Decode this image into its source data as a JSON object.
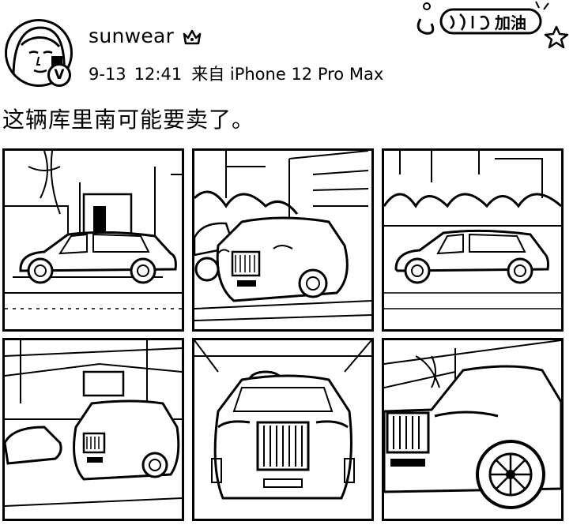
{
  "post": {
    "username": "sunwear",
    "date": "9-13",
    "time": "12:41",
    "source": "来自 iPhone 12 Pro Max",
    "text": "这辆库里南可能要卖了。",
    "verified_badge": "V"
  },
  "sticker": {
    "text": "加油"
  },
  "icons": {
    "vip": "vip-crown-icon",
    "verified": "verified-badge-icon",
    "star": "star-icon"
  },
  "photos": [
    {
      "name": "photo-1-side-view-street"
    },
    {
      "name": "photo-2-front-three-quarter-street"
    },
    {
      "name": "photo-3-side-view-trees"
    },
    {
      "name": "photo-4-showroom"
    },
    {
      "name": "photo-5-front-grille"
    },
    {
      "name": "photo-6-front-wheel-closeup"
    }
  ]
}
